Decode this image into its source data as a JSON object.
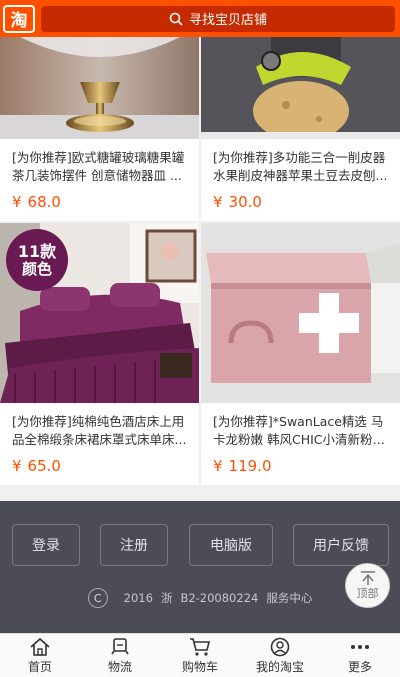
{
  "header": {
    "logo_text": "淘",
    "search_placeholder": "寻找宝贝店铺"
  },
  "products": [
    {
      "title": "[为你推荐]欧式糖罐玻璃糖果罐茶几装饰摆件 创意储物器皿 ...",
      "currency": "¥",
      "price": "68.0"
    },
    {
      "title": "[为你推荐]多功能三合一削皮器水果削皮神器苹果土豆去皮刨...",
      "currency": "¥",
      "price": "30.0"
    },
    {
      "title": "[为你推荐]纯棉纯色酒店床上用品全棉缎条床裙床罩式床单床...",
      "currency": "¥",
      "price": "65.0",
      "badge_number": "11款",
      "badge_label": "颜色"
    },
    {
      "title": "[为你推荐]*SwanLace精选 马卡龙粉嫩 韩风CHIC小清新粉嫩...",
      "currency": "¥",
      "price": "119.0"
    }
  ],
  "footer": {
    "buttons": [
      "登录",
      "注册",
      "电脑版",
      "用户反馈"
    ],
    "copyright_symbol": "C",
    "year": "2016",
    "province": "浙",
    "license": "B2-20080224",
    "service": "服务中心"
  },
  "to_top_label": "顶部",
  "tabbar": [
    {
      "label": "首页",
      "icon": "home-icon"
    },
    {
      "label": "物流",
      "icon": "truck-icon"
    },
    {
      "label": "购物车",
      "icon": "cart-icon"
    },
    {
      "label": "我的淘宝",
      "icon": "user-icon"
    },
    {
      "label": "更多",
      "icon": "more-icon"
    }
  ],
  "colors": {
    "brand": "#ff5000",
    "footer_bg": "#4b4c55"
  }
}
